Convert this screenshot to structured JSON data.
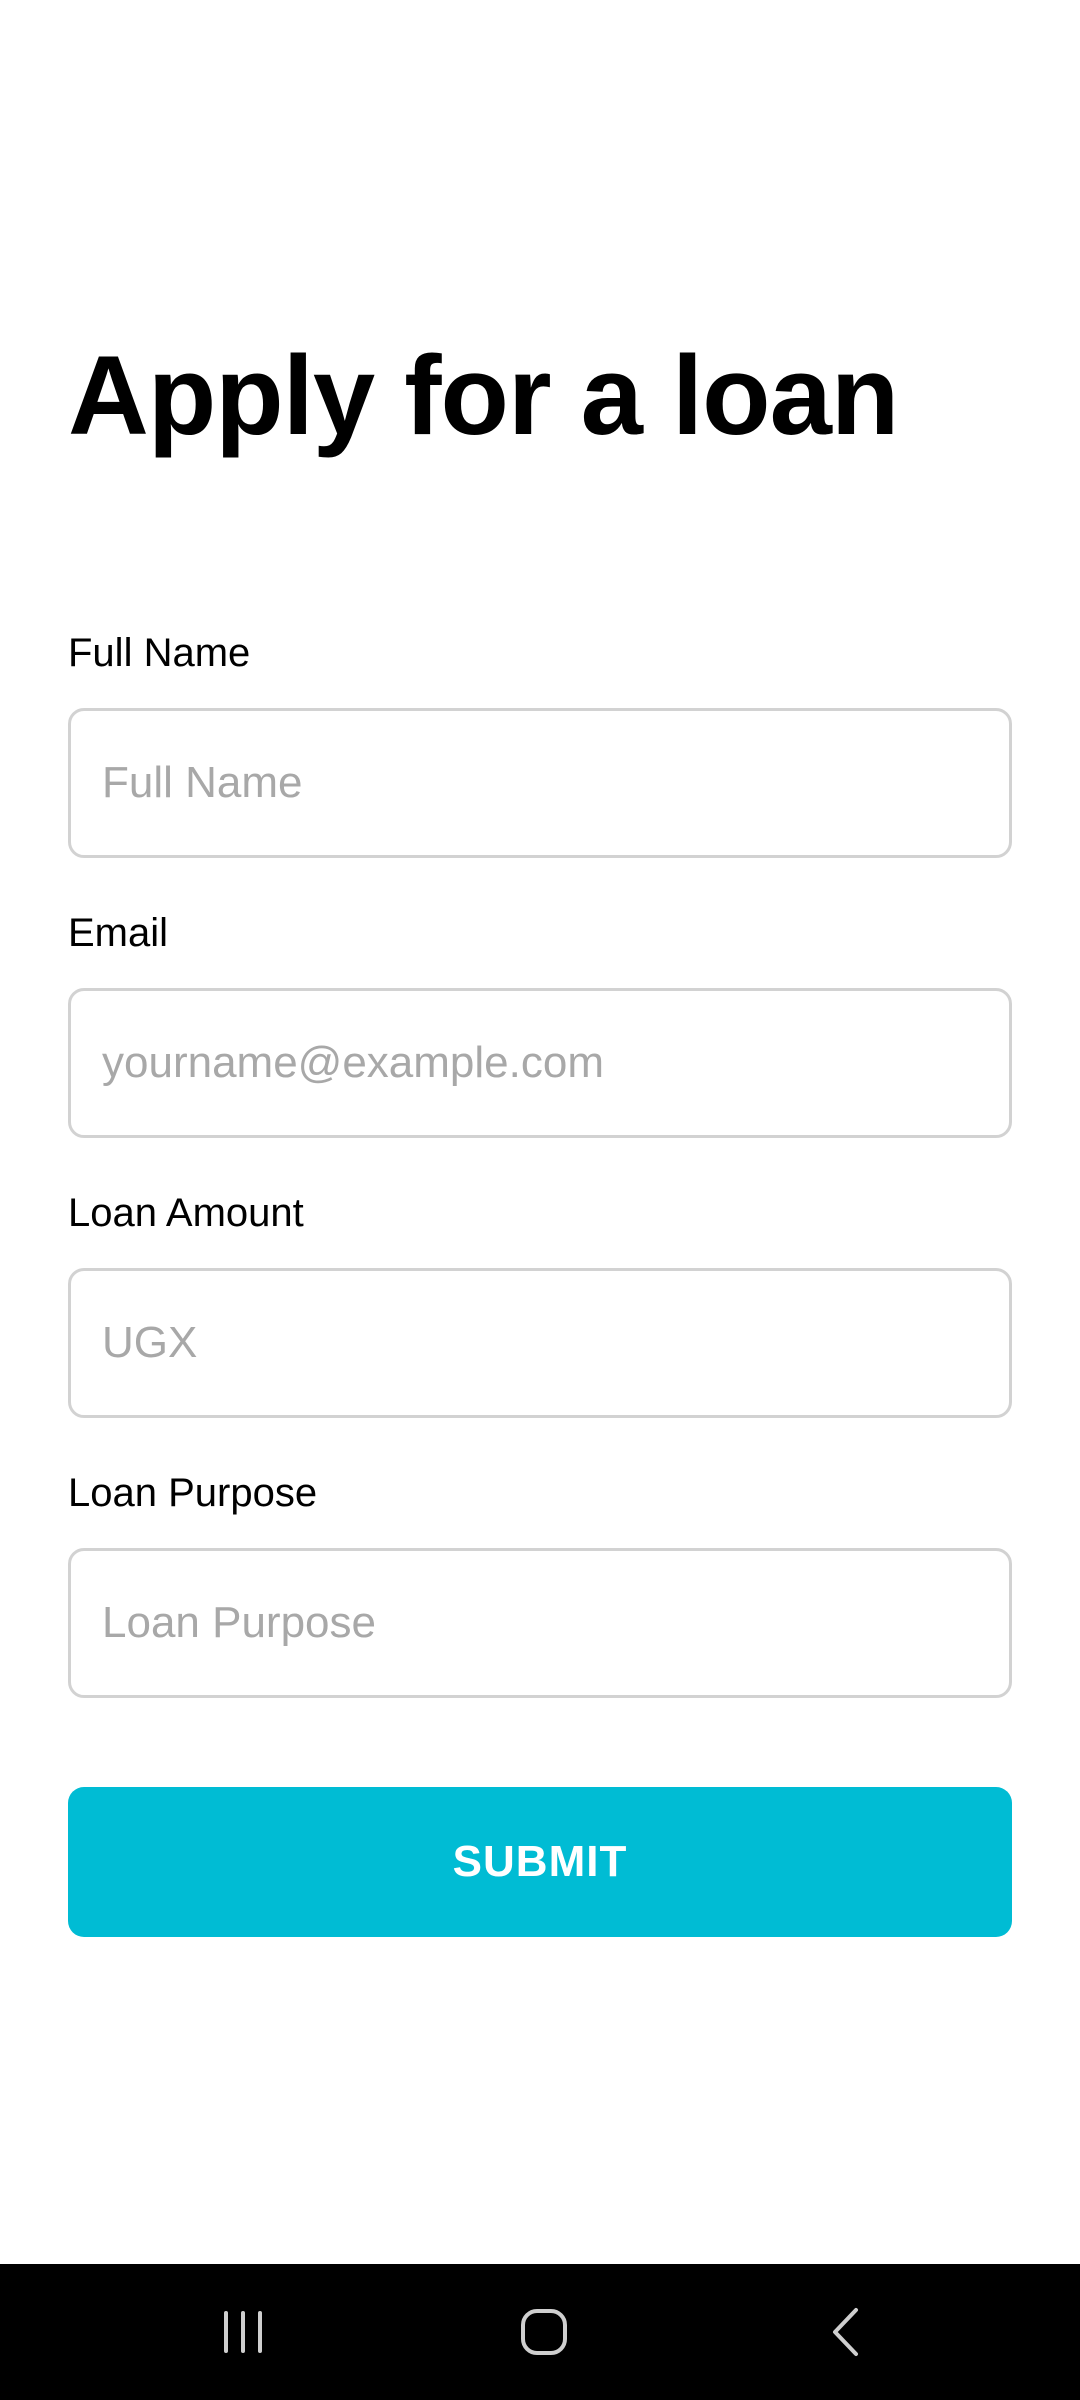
{
  "page": {
    "title": "Apply for a loan"
  },
  "form": {
    "fields": [
      {
        "label": "Full Name",
        "placeholder": "Full Name",
        "value": ""
      },
      {
        "label": "Email",
        "placeholder": "yourname@example.com",
        "value": ""
      },
      {
        "label": "Loan Amount",
        "placeholder": "UGX",
        "value": ""
      },
      {
        "label": "Loan Purpose",
        "placeholder": "Loan Purpose",
        "value": ""
      }
    ],
    "submit_label": "SUBMIT"
  },
  "navigation_bar": {
    "buttons": [
      {
        "icon": "recent-apps-icon"
      },
      {
        "icon": "home-icon"
      },
      {
        "icon": "back-icon"
      }
    ]
  },
  "colors": {
    "accent": "#00bcd4",
    "input_border": "#d2d2d2",
    "placeholder": "#a8a8a8",
    "nav_bar_background": "#000000"
  }
}
